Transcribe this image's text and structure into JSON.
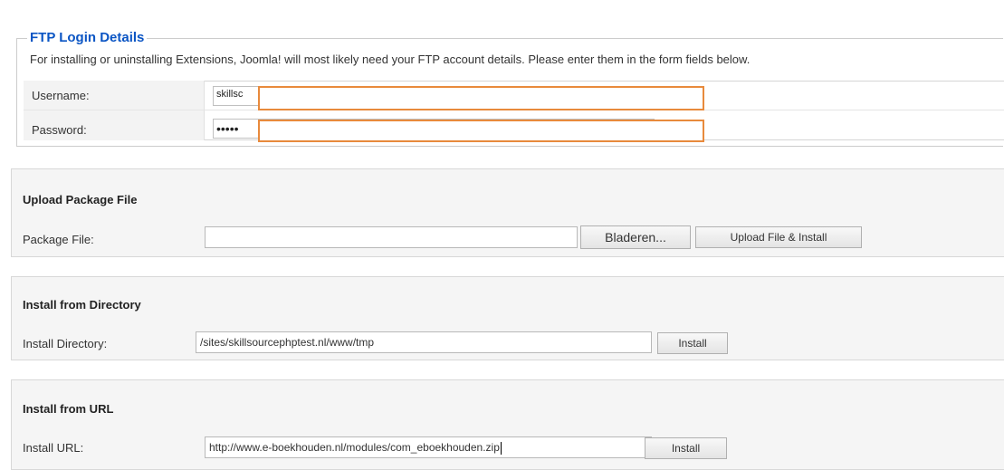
{
  "ftp": {
    "legend": "FTP Login Details",
    "description": "For installing or uninstalling Extensions, Joomla! will most likely need your FTP account details. Please enter them in the form fields below.",
    "username_label": "Username:",
    "username_value": "skillsc",
    "password_label": "Password:",
    "password_value": "•••••",
    "mask_color": "#e88a3c"
  },
  "upload": {
    "title": "Upload Package File",
    "label": "Package File:",
    "value": "",
    "browse_label": "Bladeren...",
    "submit_label": "Upload File & Install"
  },
  "directory": {
    "title": "Install from Directory",
    "label": "Install Directory:",
    "value": "/sites/skillsourcephptest.nl/www/tmp",
    "submit_label": "Install"
  },
  "url": {
    "title": "Install from URL",
    "label": "Install URL:",
    "value": "http://www.e-boekhouden.nl/modules/com_eboekhouden.zip",
    "submit_label": "Install"
  },
  "colors": {
    "legend": "#0b55c4",
    "section_bg": "#f5f5f5"
  }
}
